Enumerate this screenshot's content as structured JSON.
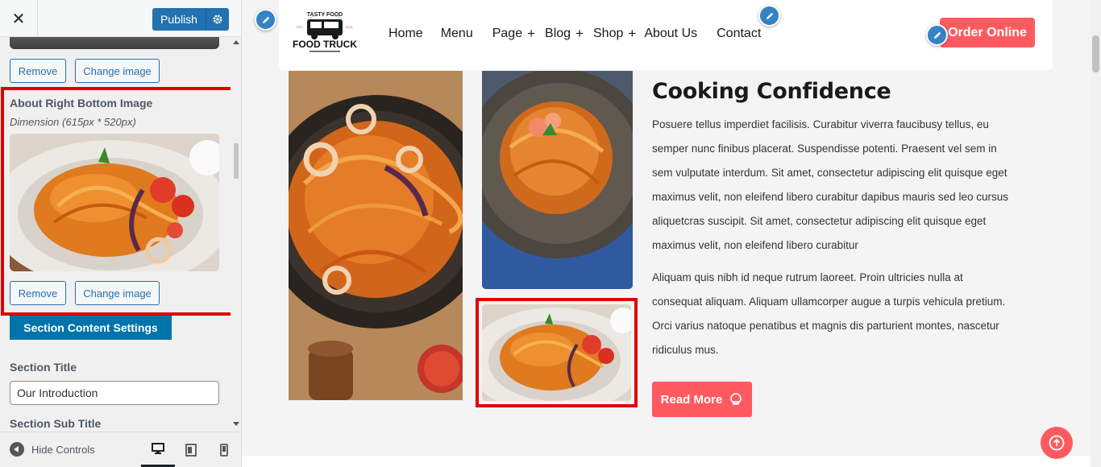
{
  "sidebar": {
    "close_label": "✕",
    "publish_label": "Publish",
    "remove_label": "Remove",
    "change_image_label": "Change image",
    "control_title": "About Right Bottom Image",
    "control_desc": "Dimension (615px * 520px)",
    "section_button": "Section Content Settings",
    "section_title_label": "Section Title",
    "section_title_value": "Our Introduction",
    "section_subtitle_label": "Section Sub Title",
    "hide_controls": "Hide Controls"
  },
  "header": {
    "logo_top": "TASTY FOOD",
    "logo_main": "FOOD TRUCK",
    "logo_est": "EST",
    "logo_year": "2021",
    "menu": [
      {
        "label": "Home",
        "plus": ""
      },
      {
        "label": "Menu",
        "plus": ""
      },
      {
        "label": "Page",
        "plus": "+"
      },
      {
        "label": "Blog",
        "plus": "+"
      },
      {
        "label": "Shop",
        "plus": "+"
      },
      {
        "label": "About Us",
        "plus": ""
      },
      {
        "label": "Contact",
        "plus": ""
      }
    ],
    "order_button": "Order Online"
  },
  "about": {
    "title": "Cooking Confidence",
    "paragraph1": "Posuere tellus imperdiet facilisis. Curabitur viverra faucibusy tellus, eu semper nunc finibus placerat. Suspendisse potenti. Praesent vel sem in sem vulputate interdum. Sit amet, consectetur adipiscing elit quisque eget maximus velit, non eleifend libero curabitur dapibus mauris sed leo cursus aliquetcras suscipit. Sit amet, consectetur adipiscing elit quisque eget maximus velit, non eleifend libero curabitur",
    "paragraph2": "Aliquam quis nibh id neque rutrum laoreet. Proin ultricies nulla at consequat aliquam. Aliquam ullamcorper augue a turpis vehicula pretium. Orci varius natoque penatibus et magnis dis parturient montes, nascetur ridiculus mus.",
    "read_more": "Read More"
  },
  "colors": {
    "accent": "#ff5a5f",
    "wp_blue": "#2271b1",
    "highlight": "#e00000"
  }
}
